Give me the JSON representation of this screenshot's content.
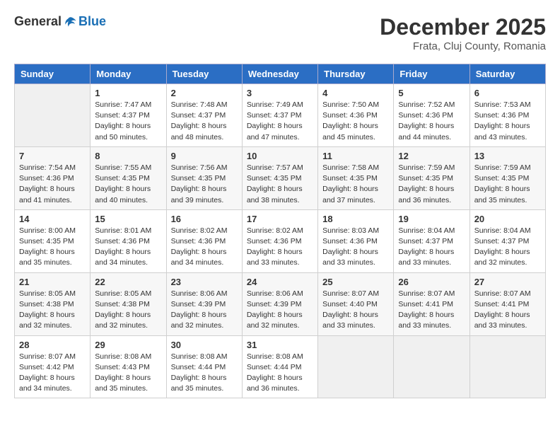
{
  "header": {
    "logo_general": "General",
    "logo_blue": "Blue",
    "month_year": "December 2025",
    "location": "Frata, Cluj County, Romania"
  },
  "days_of_week": [
    "Sunday",
    "Monday",
    "Tuesday",
    "Wednesday",
    "Thursday",
    "Friday",
    "Saturday"
  ],
  "weeks": [
    [
      {
        "day": "",
        "sunrise": "",
        "sunset": "",
        "daylight": ""
      },
      {
        "day": "1",
        "sunrise": "Sunrise: 7:47 AM",
        "sunset": "Sunset: 4:37 PM",
        "daylight": "Daylight: 8 hours and 50 minutes."
      },
      {
        "day": "2",
        "sunrise": "Sunrise: 7:48 AM",
        "sunset": "Sunset: 4:37 PM",
        "daylight": "Daylight: 8 hours and 48 minutes."
      },
      {
        "day": "3",
        "sunrise": "Sunrise: 7:49 AM",
        "sunset": "Sunset: 4:37 PM",
        "daylight": "Daylight: 8 hours and 47 minutes."
      },
      {
        "day": "4",
        "sunrise": "Sunrise: 7:50 AM",
        "sunset": "Sunset: 4:36 PM",
        "daylight": "Daylight: 8 hours and 45 minutes."
      },
      {
        "day": "5",
        "sunrise": "Sunrise: 7:52 AM",
        "sunset": "Sunset: 4:36 PM",
        "daylight": "Daylight: 8 hours and 44 minutes."
      },
      {
        "day": "6",
        "sunrise": "Sunrise: 7:53 AM",
        "sunset": "Sunset: 4:36 PM",
        "daylight": "Daylight: 8 hours and 43 minutes."
      }
    ],
    [
      {
        "day": "7",
        "sunrise": "Sunrise: 7:54 AM",
        "sunset": "Sunset: 4:36 PM",
        "daylight": "Daylight: 8 hours and 41 minutes."
      },
      {
        "day": "8",
        "sunrise": "Sunrise: 7:55 AM",
        "sunset": "Sunset: 4:35 PM",
        "daylight": "Daylight: 8 hours and 40 minutes."
      },
      {
        "day": "9",
        "sunrise": "Sunrise: 7:56 AM",
        "sunset": "Sunset: 4:35 PM",
        "daylight": "Daylight: 8 hours and 39 minutes."
      },
      {
        "day": "10",
        "sunrise": "Sunrise: 7:57 AM",
        "sunset": "Sunset: 4:35 PM",
        "daylight": "Daylight: 8 hours and 38 minutes."
      },
      {
        "day": "11",
        "sunrise": "Sunrise: 7:58 AM",
        "sunset": "Sunset: 4:35 PM",
        "daylight": "Daylight: 8 hours and 37 minutes."
      },
      {
        "day": "12",
        "sunrise": "Sunrise: 7:59 AM",
        "sunset": "Sunset: 4:35 PM",
        "daylight": "Daylight: 8 hours and 36 minutes."
      },
      {
        "day": "13",
        "sunrise": "Sunrise: 7:59 AM",
        "sunset": "Sunset: 4:35 PM",
        "daylight": "Daylight: 8 hours and 35 minutes."
      }
    ],
    [
      {
        "day": "14",
        "sunrise": "Sunrise: 8:00 AM",
        "sunset": "Sunset: 4:35 PM",
        "daylight": "Daylight: 8 hours and 35 minutes."
      },
      {
        "day": "15",
        "sunrise": "Sunrise: 8:01 AM",
        "sunset": "Sunset: 4:36 PM",
        "daylight": "Daylight: 8 hours and 34 minutes."
      },
      {
        "day": "16",
        "sunrise": "Sunrise: 8:02 AM",
        "sunset": "Sunset: 4:36 PM",
        "daylight": "Daylight: 8 hours and 34 minutes."
      },
      {
        "day": "17",
        "sunrise": "Sunrise: 8:02 AM",
        "sunset": "Sunset: 4:36 PM",
        "daylight": "Daylight: 8 hours and 33 minutes."
      },
      {
        "day": "18",
        "sunrise": "Sunrise: 8:03 AM",
        "sunset": "Sunset: 4:36 PM",
        "daylight": "Daylight: 8 hours and 33 minutes."
      },
      {
        "day": "19",
        "sunrise": "Sunrise: 8:04 AM",
        "sunset": "Sunset: 4:37 PM",
        "daylight": "Daylight: 8 hours and 33 minutes."
      },
      {
        "day": "20",
        "sunrise": "Sunrise: 8:04 AM",
        "sunset": "Sunset: 4:37 PM",
        "daylight": "Daylight: 8 hours and 32 minutes."
      }
    ],
    [
      {
        "day": "21",
        "sunrise": "Sunrise: 8:05 AM",
        "sunset": "Sunset: 4:38 PM",
        "daylight": "Daylight: 8 hours and 32 minutes."
      },
      {
        "day": "22",
        "sunrise": "Sunrise: 8:05 AM",
        "sunset": "Sunset: 4:38 PM",
        "daylight": "Daylight: 8 hours and 32 minutes."
      },
      {
        "day": "23",
        "sunrise": "Sunrise: 8:06 AM",
        "sunset": "Sunset: 4:39 PM",
        "daylight": "Daylight: 8 hours and 32 minutes."
      },
      {
        "day": "24",
        "sunrise": "Sunrise: 8:06 AM",
        "sunset": "Sunset: 4:39 PM",
        "daylight": "Daylight: 8 hours and 32 minutes."
      },
      {
        "day": "25",
        "sunrise": "Sunrise: 8:07 AM",
        "sunset": "Sunset: 4:40 PM",
        "daylight": "Daylight: 8 hours and 33 minutes."
      },
      {
        "day": "26",
        "sunrise": "Sunrise: 8:07 AM",
        "sunset": "Sunset: 4:41 PM",
        "daylight": "Daylight: 8 hours and 33 minutes."
      },
      {
        "day": "27",
        "sunrise": "Sunrise: 8:07 AM",
        "sunset": "Sunset: 4:41 PM",
        "daylight": "Daylight: 8 hours and 33 minutes."
      }
    ],
    [
      {
        "day": "28",
        "sunrise": "Sunrise: 8:07 AM",
        "sunset": "Sunset: 4:42 PM",
        "daylight": "Daylight: 8 hours and 34 minutes."
      },
      {
        "day": "29",
        "sunrise": "Sunrise: 8:08 AM",
        "sunset": "Sunset: 4:43 PM",
        "daylight": "Daylight: 8 hours and 35 minutes."
      },
      {
        "day": "30",
        "sunrise": "Sunrise: 8:08 AM",
        "sunset": "Sunset: 4:44 PM",
        "daylight": "Daylight: 8 hours and 35 minutes."
      },
      {
        "day": "31",
        "sunrise": "Sunrise: 8:08 AM",
        "sunset": "Sunset: 4:44 PM",
        "daylight": "Daylight: 8 hours and 36 minutes."
      },
      {
        "day": "",
        "sunrise": "",
        "sunset": "",
        "daylight": ""
      },
      {
        "day": "",
        "sunrise": "",
        "sunset": "",
        "daylight": ""
      },
      {
        "day": "",
        "sunrise": "",
        "sunset": "",
        "daylight": ""
      }
    ]
  ]
}
